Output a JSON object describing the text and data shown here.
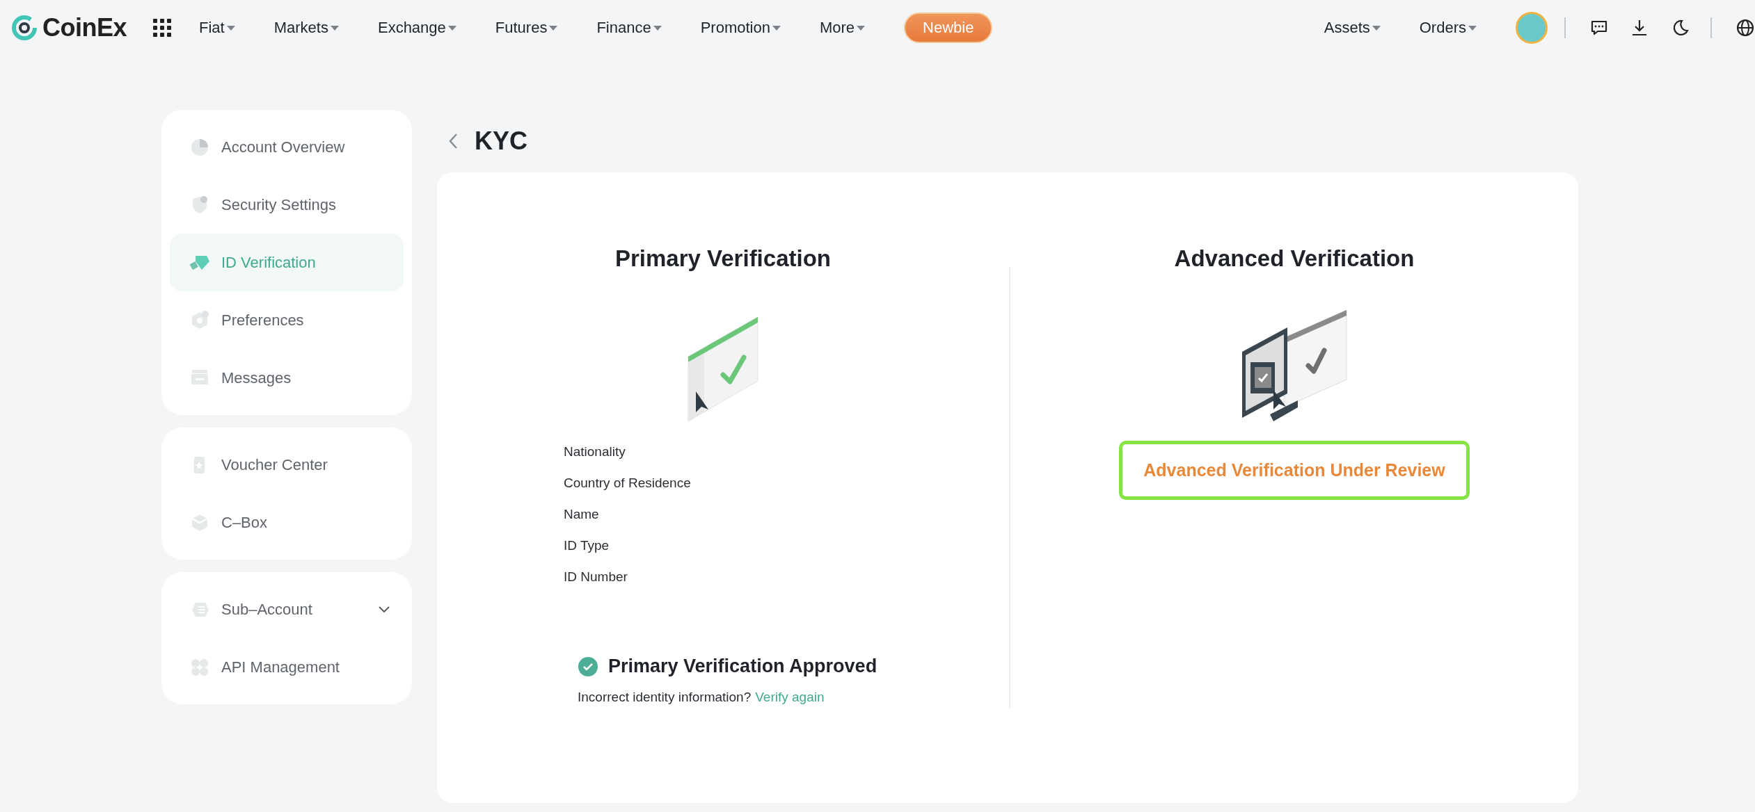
{
  "nav": {
    "logo": "CoinEx",
    "menus": [
      {
        "label": "Fiat"
      },
      {
        "label": "Markets"
      },
      {
        "label": "Exchange"
      },
      {
        "label": "Futures"
      },
      {
        "label": "Finance"
      },
      {
        "label": "Promotion"
      },
      {
        "label": "More"
      }
    ],
    "badge": "Newbie",
    "right_menus": [
      {
        "label": "Assets"
      },
      {
        "label": "Orders"
      }
    ]
  },
  "sidebar": {
    "groups": [
      {
        "items": [
          {
            "label": "Account Overview",
            "selected": false
          },
          {
            "label": "Security Settings",
            "selected": false
          },
          {
            "label": "ID Verification",
            "selected": true
          },
          {
            "label": "Preferences",
            "selected": false
          },
          {
            "label": "Messages",
            "selected": false
          }
        ]
      },
      {
        "items": [
          {
            "label": "Voucher Center",
            "selected": false
          },
          {
            "label": "C–Box",
            "selected": false
          }
        ]
      },
      {
        "items": [
          {
            "label": "Sub–Account",
            "selected": false,
            "expanded": false
          },
          {
            "label": "API Management",
            "selected": false
          }
        ]
      }
    ]
  },
  "page": {
    "title": "KYC"
  },
  "primary": {
    "title": "Primary Verification",
    "fields": [
      "Nationality",
      "Country of Residence",
      "Name",
      "ID Type",
      "ID Number"
    ],
    "status": "Primary Verification Approved",
    "note": "Incorrect identity information?",
    "link": "Verify again"
  },
  "advanced": {
    "title": "Advanced Verification",
    "status": "Advanced Verification Under Review"
  }
}
